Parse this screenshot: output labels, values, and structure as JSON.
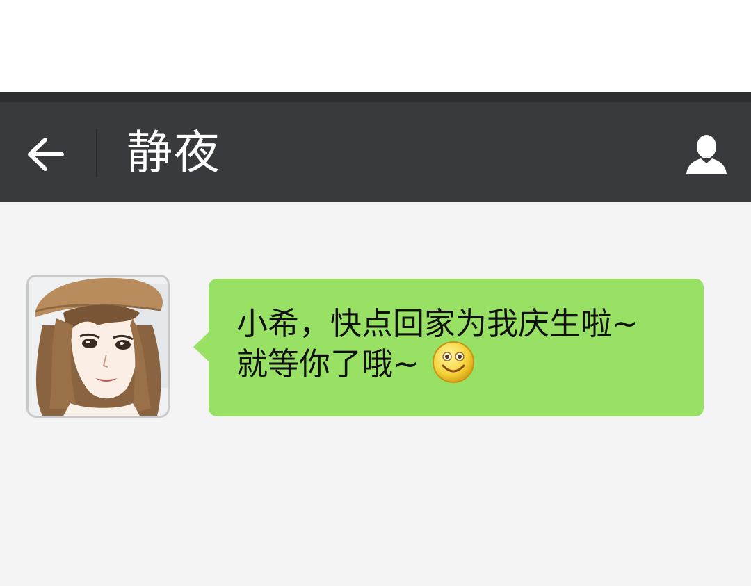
{
  "header": {
    "title": "静夜",
    "back_icon": "arrow-left-icon",
    "profile_icon": "person-icon"
  },
  "message": {
    "sender": "静夜",
    "line1": "小希，快点回家为我庆生啦~",
    "line2": "就等你了哦~",
    "emoji": "smiley-face-icon"
  },
  "colors": {
    "header_bg": "#393a3e",
    "chat_bg": "#f4f4f4",
    "bubble_bg": "#98e165",
    "title_text": "#ffffff"
  }
}
